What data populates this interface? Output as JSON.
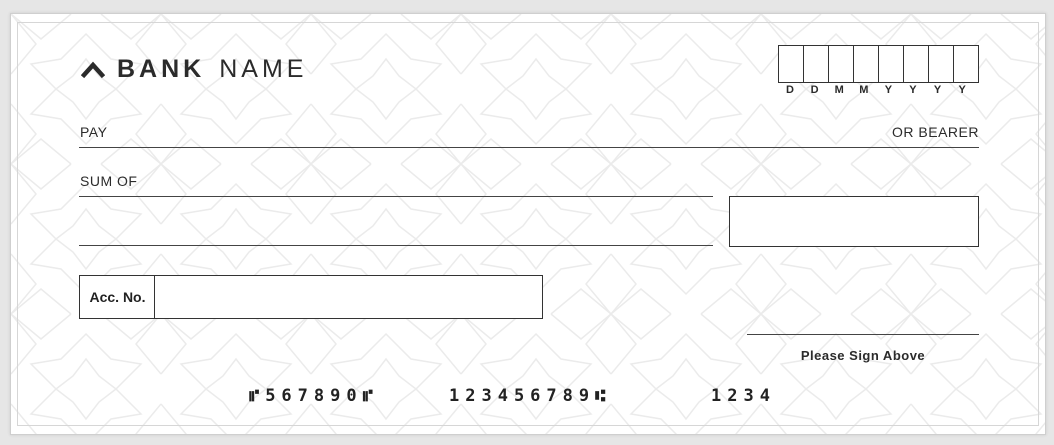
{
  "bank": {
    "name_bold": "BANK",
    "name_regular": "NAME",
    "logo_icon": "caret-up-icon"
  },
  "date": {
    "labels": [
      "D",
      "D",
      "M",
      "M",
      "Y",
      "Y",
      "Y",
      "Y"
    ]
  },
  "fields": {
    "pay_label": "PAY",
    "or_bearer_label": "OR BEARER",
    "sum_of_label": "SUM OF",
    "acc_no_label": "Acc. No."
  },
  "signature": {
    "label": "Please Sign Above"
  },
  "micr": {
    "cheque_number": "⑈567890⑈",
    "routing_number": "123456789⑆",
    "account_code": "1234"
  },
  "colors": {
    "paper": "#ffffff",
    "ink": "#2b2b2b",
    "pattern": "#ececec",
    "background": "#e6e6e6"
  }
}
